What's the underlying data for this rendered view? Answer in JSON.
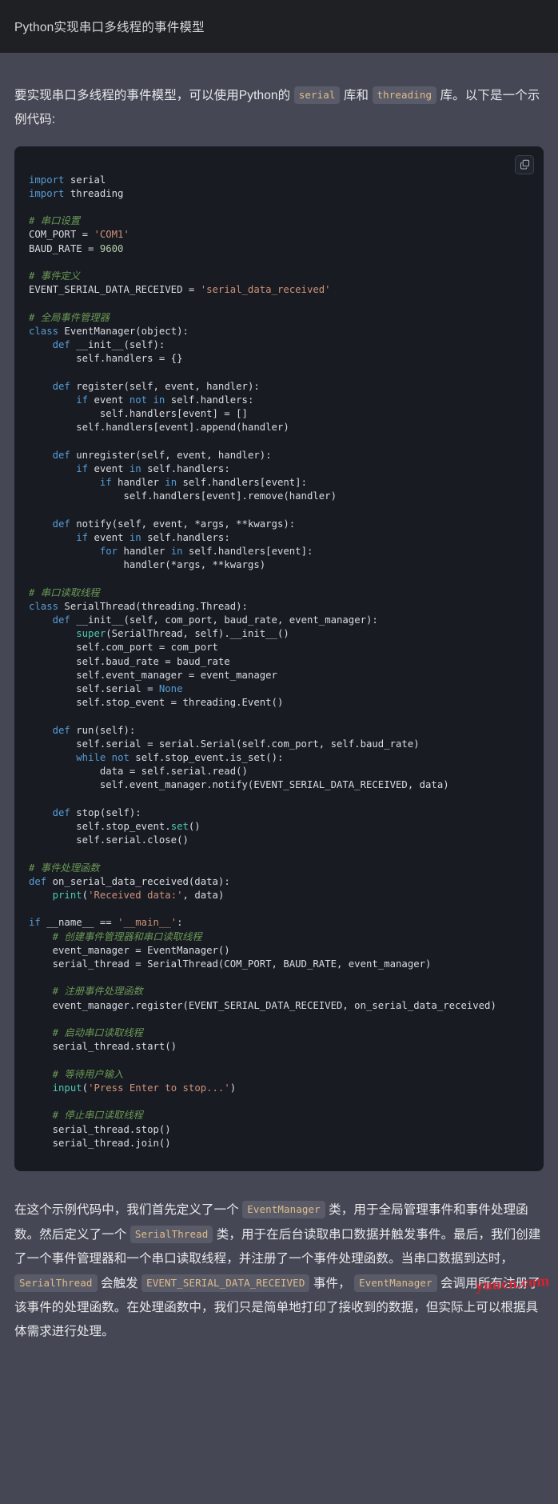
{
  "header": {
    "title": "Python实现串口多线程的事件模型"
  },
  "intro": {
    "part1": "要实现串口多线程的事件模型，可以使用Python的",
    "code1": "serial",
    "part2": "库和",
    "code2": "threading",
    "part3": "库。以下是一个示例代码:"
  },
  "codeblock": {
    "language": "python",
    "copy_icon": "copy-icon",
    "lines": [
      [
        {
          "t": "import",
          "c": "k"
        },
        {
          "t": " serial",
          "c": "t"
        }
      ],
      [
        {
          "t": "import",
          "c": "k"
        },
        {
          "t": " threading",
          "c": "t"
        }
      ],
      [],
      [
        {
          "t": "# 串口设置",
          "c": "cm"
        }
      ],
      [
        {
          "t": "COM_PORT = ",
          "c": "t"
        },
        {
          "t": "'COM1'",
          "c": "s"
        }
      ],
      [
        {
          "t": "BAUD_RATE = ",
          "c": "t"
        },
        {
          "t": "9600",
          "c": "n"
        }
      ],
      [],
      [
        {
          "t": "# 事件定义",
          "c": "cm"
        }
      ],
      [
        {
          "t": "EVENT_SERIAL_DATA_RECEIVED = ",
          "c": "t"
        },
        {
          "t": "'serial_data_received'",
          "c": "s"
        }
      ],
      [],
      [
        {
          "t": "# 全局事件管理器",
          "c": "cm"
        }
      ],
      [
        {
          "t": "class",
          "c": "k"
        },
        {
          "t": " EventManager(object):",
          "c": "t"
        }
      ],
      [
        {
          "t": "    ",
          "c": "t"
        },
        {
          "t": "def",
          "c": "k"
        },
        {
          "t": " __init__(self):",
          "c": "t"
        }
      ],
      [
        {
          "t": "        self.handlers = {}",
          "c": "t"
        }
      ],
      [],
      [
        {
          "t": "    ",
          "c": "t"
        },
        {
          "t": "def",
          "c": "k"
        },
        {
          "t": " register(self, event, handler):",
          "c": "t"
        }
      ],
      [
        {
          "t": "        ",
          "c": "t"
        },
        {
          "t": "if",
          "c": "k"
        },
        {
          "t": " event ",
          "c": "t"
        },
        {
          "t": "not",
          "c": "k"
        },
        {
          "t": " ",
          "c": "t"
        },
        {
          "t": "in",
          "c": "k"
        },
        {
          "t": " self.handlers:",
          "c": "t"
        }
      ],
      [
        {
          "t": "            self.handlers[event] = []",
          "c": "t"
        }
      ],
      [
        {
          "t": "        self.handlers[event].append(handler)",
          "c": "t"
        }
      ],
      [],
      [
        {
          "t": "    ",
          "c": "t"
        },
        {
          "t": "def",
          "c": "k"
        },
        {
          "t": " unregister(self, event, handler):",
          "c": "t"
        }
      ],
      [
        {
          "t": "        ",
          "c": "t"
        },
        {
          "t": "if",
          "c": "k"
        },
        {
          "t": " event ",
          "c": "t"
        },
        {
          "t": "in",
          "c": "k"
        },
        {
          "t": " self.handlers:",
          "c": "t"
        }
      ],
      [
        {
          "t": "            ",
          "c": "t"
        },
        {
          "t": "if",
          "c": "k"
        },
        {
          "t": " handler ",
          "c": "t"
        },
        {
          "t": "in",
          "c": "k"
        },
        {
          "t": " self.handlers[event]:",
          "c": "t"
        }
      ],
      [
        {
          "t": "                self.handlers[event].remove(handler)",
          "c": "t"
        }
      ],
      [],
      [
        {
          "t": "    ",
          "c": "t"
        },
        {
          "t": "def",
          "c": "k"
        },
        {
          "t": " notify(self, event, *args, **kwargs):",
          "c": "t"
        }
      ],
      [
        {
          "t": "        ",
          "c": "t"
        },
        {
          "t": "if",
          "c": "k"
        },
        {
          "t": " event ",
          "c": "t"
        },
        {
          "t": "in",
          "c": "k"
        },
        {
          "t": " self.handlers:",
          "c": "t"
        }
      ],
      [
        {
          "t": "            ",
          "c": "t"
        },
        {
          "t": "for",
          "c": "k"
        },
        {
          "t": " handler ",
          "c": "t"
        },
        {
          "t": "in",
          "c": "k"
        },
        {
          "t": " self.handlers[event]:",
          "c": "t"
        }
      ],
      [
        {
          "t": "                handler(*args, **kwargs)",
          "c": "t"
        }
      ],
      [],
      [
        {
          "t": "# 串口读取线程",
          "c": "cm"
        }
      ],
      [
        {
          "t": "class",
          "c": "k"
        },
        {
          "t": " SerialThread(threading.Thread):",
          "c": "t"
        }
      ],
      [
        {
          "t": "    ",
          "c": "t"
        },
        {
          "t": "def",
          "c": "k"
        },
        {
          "t": " __init__(self, com_port, baud_rate, event_manager):",
          "c": "t"
        }
      ],
      [
        {
          "t": "        ",
          "c": "t"
        },
        {
          "t": "super",
          "c": "fn"
        },
        {
          "t": "(SerialThread, self).__init__()",
          "c": "t"
        }
      ],
      [
        {
          "t": "        self.com_port = com_port",
          "c": "t"
        }
      ],
      [
        {
          "t": "        self.baud_rate = baud_rate",
          "c": "t"
        }
      ],
      [
        {
          "t": "        self.event_manager = event_manager",
          "c": "t"
        }
      ],
      [
        {
          "t": "        self.serial = ",
          "c": "t"
        },
        {
          "t": "None",
          "c": "k"
        }
      ],
      [
        {
          "t": "        self.stop_event = threading.Event()",
          "c": "t"
        }
      ],
      [],
      [
        {
          "t": "    ",
          "c": "t"
        },
        {
          "t": "def",
          "c": "k"
        },
        {
          "t": " run(self):",
          "c": "t"
        }
      ],
      [
        {
          "t": "        self.serial = serial.Serial(self.com_port, self.baud_rate)",
          "c": "t"
        }
      ],
      [
        {
          "t": "        ",
          "c": "t"
        },
        {
          "t": "while",
          "c": "k"
        },
        {
          "t": " ",
          "c": "t"
        },
        {
          "t": "not",
          "c": "k"
        },
        {
          "t": " self.stop_event.is_set():",
          "c": "t"
        }
      ],
      [
        {
          "t": "            data = self.serial.read()",
          "c": "t"
        }
      ],
      [
        {
          "t": "            self.event_manager.notify(EVENT_SERIAL_DATA_RECEIVED, data)",
          "c": "t"
        }
      ],
      [],
      [
        {
          "t": "    ",
          "c": "t"
        },
        {
          "t": "def",
          "c": "k"
        },
        {
          "t": " stop(self):",
          "c": "t"
        }
      ],
      [
        {
          "t": "        self.stop_event.",
          "c": "t"
        },
        {
          "t": "set",
          "c": "fn"
        },
        {
          "t": "()",
          "c": "t"
        }
      ],
      [
        {
          "t": "        self.serial.close()",
          "c": "t"
        }
      ],
      [],
      [
        {
          "t": "# 事件处理函数",
          "c": "cm"
        }
      ],
      [
        {
          "t": "def",
          "c": "k"
        },
        {
          "t": " on_serial_data_received(data):",
          "c": "t"
        }
      ],
      [
        {
          "t": "    ",
          "c": "t"
        },
        {
          "t": "print",
          "c": "fn"
        },
        {
          "t": "(",
          "c": "t"
        },
        {
          "t": "'Received data:'",
          "c": "s"
        },
        {
          "t": ", data)",
          "c": "t"
        }
      ],
      [],
      [
        {
          "t": "if",
          "c": "k"
        },
        {
          "t": " __name__ == ",
          "c": "t"
        },
        {
          "t": "'__main__'",
          "c": "s"
        },
        {
          "t": ":",
          "c": "t"
        }
      ],
      [
        {
          "t": "    # 创建事件管理器和串口读取线程",
          "c": "cm"
        }
      ],
      [
        {
          "t": "    event_manager = EventManager()",
          "c": "t"
        }
      ],
      [
        {
          "t": "    serial_thread = SerialThread(COM_PORT, BAUD_RATE, event_manager)",
          "c": "t"
        }
      ],
      [],
      [
        {
          "t": "    # 注册事件处理函数",
          "c": "cm"
        }
      ],
      [
        {
          "t": "    event_manager.register(EVENT_SERIAL_DATA_RECEIVED, on_serial_data_received)",
          "c": "t"
        }
      ],
      [],
      [
        {
          "t": "    # 启动串口读取线程",
          "c": "cm"
        }
      ],
      [
        {
          "t": "    serial_thread.start()",
          "c": "t"
        }
      ],
      [],
      [
        {
          "t": "    # 等待用户输入",
          "c": "cm"
        }
      ],
      [
        {
          "t": "    ",
          "c": "t"
        },
        {
          "t": "input",
          "c": "fn"
        },
        {
          "t": "(",
          "c": "t"
        },
        {
          "t": "'Press Enter to stop...'",
          "c": "s"
        },
        {
          "t": ")",
          "c": "t"
        }
      ],
      [],
      [
        {
          "t": "    # 停止串口读取线程",
          "c": "cm"
        }
      ],
      [
        {
          "t": "    serial_thread.stop()",
          "c": "t"
        }
      ],
      [
        {
          "t": "    serial_thread.join()",
          "c": "t"
        }
      ]
    ]
  },
  "outro": {
    "p1": "在这个示例代码中，我们首先定义了一个",
    "c1": "EventManager",
    "p2": "类，用于全局管理事件和事件处理函数。然后定义了一个",
    "c2": "SerialThread",
    "p3": "类，用于在后台读取串口数据并触发事件。最后，我们创建了一个事件管理器和一个串口读取线程，并注册了一个事件处理函数。当串口数据到达时，",
    "c3": "SerialThread",
    "p4": "会触发",
    "c4": "EVENT_SERIAL_DATA_RECEIVED",
    "p5": "事件，",
    "c5": "EventManager",
    "p6": "会调用所有注册了该事件的处理函数。在处理函数中，我们只是简单地打印了接收到的数据，但实际上可以根据具体需求进行处理。"
  },
  "watermark": {
    "text": "yuucn.com",
    "color": "#e0202f"
  },
  "theme": {
    "page_bg": "#454754",
    "header_bg": "#1f2023",
    "code_bg": "#181b22",
    "inline_code_bg": "#595b68",
    "inline_code_fg": "#e0bc8a",
    "keyword": "#569cd6",
    "comment": "#6a9955",
    "string": "#ce9178",
    "number": "#b5cea8",
    "builtin": "#4ec9b0",
    "text": "#e8e9ec"
  }
}
